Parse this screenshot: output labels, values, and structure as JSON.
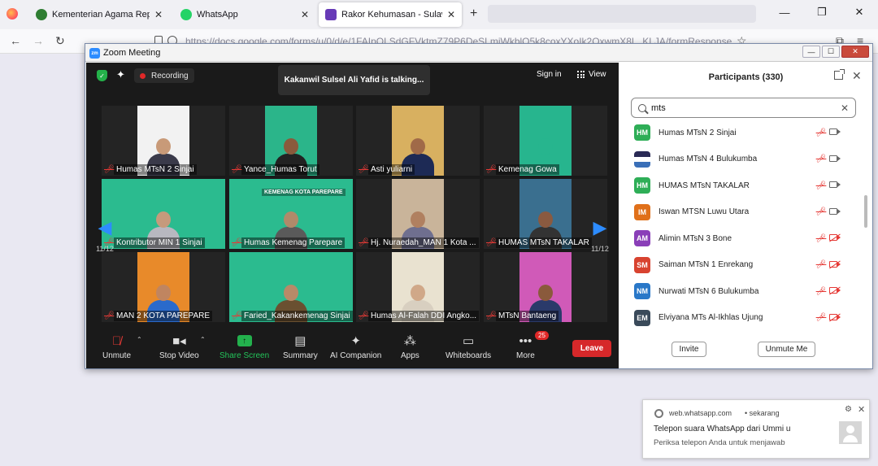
{
  "browser": {
    "tabs": [
      {
        "title": "Kementerian Agama Republik Ind",
        "icon_color": "#2e7d32"
      },
      {
        "title": "WhatsApp",
        "icon_color": "#25d366"
      },
      {
        "title": "Rakor Kehumasan - Sulawesi Sel",
        "icon_color": "#673ab7"
      }
    ],
    "new_tab": "+",
    "url": "https://docs.google.com/forms/u/0/d/e/1FAIpQLSdGFVktmZ79P6DeSLmiWkblQ5k8coxYXoIk2QxwmX8L_KLJA/formResponse"
  },
  "zoom": {
    "window_title": "Zoom Meeting",
    "recording_label": "Recording",
    "talking_toast": "Kakanwil Sulsel Ali Yafid is talking...",
    "sign_in": "Sign in",
    "view": "View",
    "page_indicator": "11/12",
    "tiles": [
      {
        "name": "Humas MTsN 2 Sinjai",
        "bg": "#f2f2f2",
        "skin": "#c89a78",
        "cloth": "#3a3a4a",
        "feed": "narrow"
      },
      {
        "name": "Yance_Humas Torut",
        "bg": "#2bb58a",
        "skin": "#8a5a3c",
        "cloth": "#222",
        "feed": "narrow"
      },
      {
        "name": "Asti yuliarni",
        "bg": "#d8b060",
        "skin": "#a06a48",
        "cloth": "#1d2a55",
        "feed": "narrow"
      },
      {
        "name": "Kemenag Gowa",
        "bg": "#27b58e",
        "skin": "#27b58e",
        "cloth": "#27b58e",
        "feed": "narrow"
      },
      {
        "name": "Kontributor MIN 1 Sinjai",
        "bg": "#2bbb8f",
        "skin": "#c59a7c",
        "cloth": "#b8b8c0",
        "feed": "wide"
      },
      {
        "name": "Humas Kemenag Parepare",
        "bg": "#2bbb8f",
        "skin": "#b08a6a",
        "cloth": "#5a5a5a",
        "feed": "wide",
        "banner": "KEMENAG KOTA PAREPARE"
      },
      {
        "name": "Hj. Nuraedah_MAN 1 Kota ...",
        "bg": "#c9b49a",
        "skin": "#b08060",
        "cloth": "#6f6f8f",
        "feed": "narrow"
      },
      {
        "name": "HUMAS MTsN TAKALAR",
        "bg": "#3a6f8f",
        "skin": "#8a5a40",
        "cloth": "#333",
        "feed": "narrow"
      },
      {
        "name": "MAN 2 KOTA PAREPARE",
        "bg": "#e88a2a",
        "skin": "#c08560",
        "cloth": "#2a6acb",
        "feed": "narrow"
      },
      {
        "name": "Faried_Kakankemenag Sinjai",
        "bg": "#2bbb8f",
        "skin": "#b88a68",
        "cloth": "#6a5030",
        "feed": "wide"
      },
      {
        "name": "Humas Al-Falah DDI Angko...",
        "bg": "#e9e2d0",
        "skin": "#d0a888",
        "cloth": "#d8cfc0",
        "feed": "narrow"
      },
      {
        "name": "MTsN Bantaeng",
        "bg": "#d05ab8",
        "skin": "#8a5a3c",
        "cloth": "#2a3a6a",
        "feed": "narrow"
      }
    ],
    "toolbar": {
      "unmute": "Unmute",
      "stop_video": "Stop Video",
      "share_screen": "Share Screen",
      "summary": "Summary",
      "ai_companion": "AI Companion",
      "apps": "Apps",
      "whiteboards": "Whiteboards",
      "more": "More",
      "more_badge": "25",
      "leave": "Leave"
    },
    "participants": {
      "title": "Participants (330)",
      "search_value": "mts",
      "list": [
        {
          "initials": "HM",
          "name": "Humas MTsN 2 Sinjai",
          "color": "#2eae57",
          "video": "on"
        },
        {
          "initials": "",
          "name": "Humas MTsN 4 Bulukumba",
          "color": "#6a6a7a",
          "video": "on"
        },
        {
          "initials": "HM",
          "name": "HUMAS MTsN TAKALAR",
          "color": "#2eae57",
          "video": "on"
        },
        {
          "initials": "IM",
          "name": "Iswan MTSN Luwu Utara",
          "color": "#e0701a",
          "video": "on"
        },
        {
          "initials": "AM",
          "name": "Alimin MTsN 3 Bone",
          "color": "#8a3fb8",
          "video": "off"
        },
        {
          "initials": "SM",
          "name": "Saiman MTsN 1 Enrekang",
          "color": "#d84330",
          "video": "off"
        },
        {
          "initials": "NM",
          "name": "Nurwati MTsN 6 Bulukumba",
          "color": "#2a78c8",
          "video": "off"
        },
        {
          "initials": "EM",
          "name": "Elviyana MTs Al-Ikhlas Ujung",
          "color": "#3a4a5a",
          "video": "off"
        }
      ],
      "invite": "Invite",
      "unmute_me": "Unmute Me"
    }
  },
  "notification": {
    "source": "web.whatsapp.com",
    "time": "• sekarang",
    "title": "Telepon suara WhatsApp dari Ummi u",
    "body": "Periksa telepon Anda untuk menjawab"
  },
  "colors": {
    "accent": "#2d8cff",
    "leave": "#d6282a",
    "mic_off": "#e53935",
    "share": "#23b14d"
  }
}
